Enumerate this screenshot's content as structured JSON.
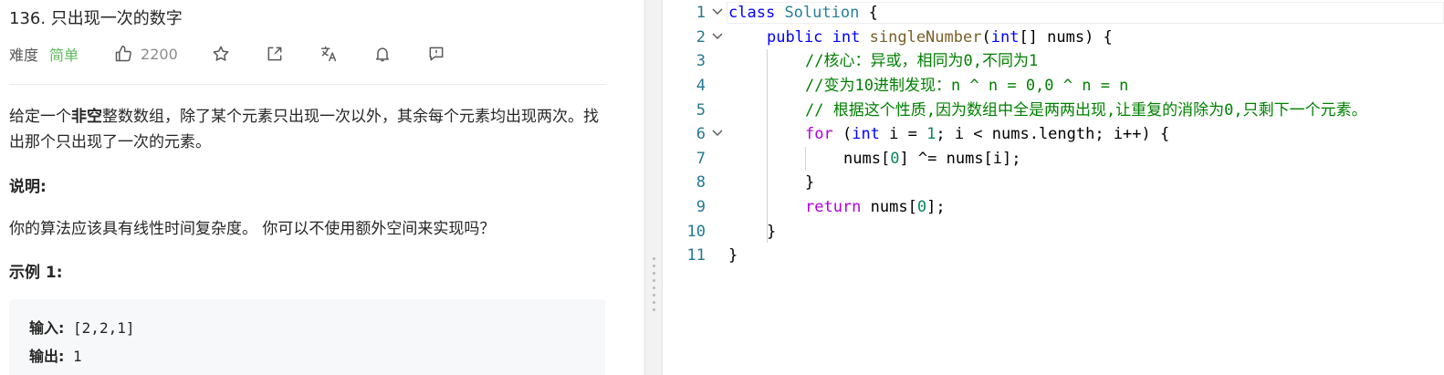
{
  "problem": {
    "title": "136. 只出现一次的数字",
    "difficulty_label": "难度",
    "difficulty_value": "简单",
    "like_count": "2200",
    "desc_part1": "给定一个",
    "desc_bold": "非空",
    "desc_part2": "整数数组，除了某个元素只出现一次以外，其余每个元素均出现两次。找出那个只出现了一次的元素。",
    "explain_heading": "说明:",
    "explain_text": "你的算法应该具有线性时间复杂度。 你可以不使用额外空间来实现吗？",
    "example_heading": "示例 1:",
    "example_input_label": "输入:",
    "example_input_value": " [2,2,1]",
    "example_output_label": "输出:",
    "example_output_value": " 1"
  },
  "icons": [
    "thumbs-up-icon",
    "star-icon",
    "share-icon",
    "translate-icon",
    "bell-icon",
    "feedback-icon"
  ],
  "editor": {
    "line_numbers": [
      "1",
      "2",
      "3",
      "4",
      "5",
      "6",
      "7",
      "8",
      "9",
      "10",
      "11"
    ],
    "tokens": {
      "l1_kw": "class",
      "l1_cls": "Solution",
      "l1_rest": " {",
      "l2_kw1": "public",
      "l2_kw2": "int",
      "l2_fn": "singleNumber",
      "l2_p1": "(",
      "l2_ty": "int",
      "l2_p2": "[] nums) {",
      "l3_cm": "//核心：异或，相同为0,不同为1",
      "l4_cm": "//变为10进制发现：n ^ n = 0,0 ^ n = n",
      "l5_cm": "// 根据这个性质,因为数组中全是两两出现,让重复的消除为0,只剩下一个元素。",
      "l6_kw": "for",
      "l6_a": " (",
      "l6_ty": "int",
      "l6_b": " i = ",
      "l6_n": "1",
      "l6_c": "; i < nums.length; i++) {",
      "l7_a": "nums[",
      "l7_n": "0",
      "l7_b": "] ^= nums[i];",
      "l8": "}",
      "l9_kw": "return",
      "l9_a": " nums[",
      "l9_n": "0",
      "l9_b": "];",
      "l10": "}",
      "l11": "}"
    }
  },
  "colors": {
    "easy": "#5cb85c",
    "keyword": "#0000ff",
    "control": "#af00db",
    "comment": "#008000",
    "number": "#098658",
    "class": "#267f99",
    "function": "#795e26",
    "line_number": "#237893"
  }
}
